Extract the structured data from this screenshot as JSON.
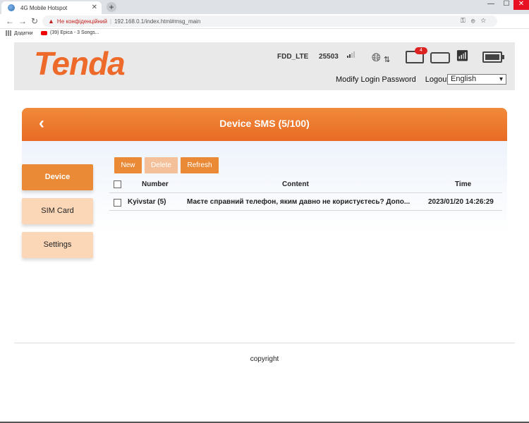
{
  "browser": {
    "tab_title": "4G Mobile Hotspot",
    "not_secure": "Не конфіденційний",
    "url": "192.168.0.1/index.html#msg_main",
    "profile_initial": "A",
    "bookmarks": [
      {
        "label": "Додатки",
        "icon": "apps-icon"
      },
      {
        "label": "(39) Epica - 3 Songs...",
        "icon": "youtube-icon"
      }
    ]
  },
  "header": {
    "logo": "Tenda",
    "network_type": "FDD_LTE",
    "operator_code": "25503",
    "sms_badge": "4",
    "modify_password": "Modify Login Password",
    "logout": "Logout",
    "language": "English",
    "brand_color": "#ed6a2b"
  },
  "banner": {
    "title": "Device SMS (5/100)"
  },
  "sidebar": {
    "items": [
      {
        "label": "Device",
        "active": true
      },
      {
        "label": "SIM Card",
        "active": false
      },
      {
        "label": "Settings",
        "active": false
      }
    ]
  },
  "actions": {
    "new": "New",
    "delete": "Delete",
    "refresh": "Refresh"
  },
  "table": {
    "headers": {
      "number": "Number",
      "content": "Content",
      "time": "Time"
    },
    "rows": [
      {
        "number": "Kyivstar (5)",
        "content": "Маєте справний телефон, яким давно не користуєтесь? Допо...",
        "time": "2023/01/20 14:26:29"
      }
    ]
  },
  "footer": {
    "copyright": "copyright"
  }
}
